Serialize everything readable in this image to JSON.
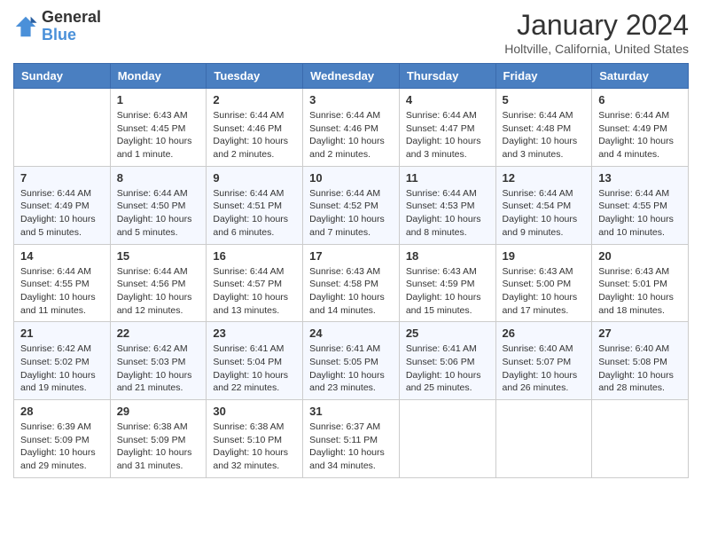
{
  "header": {
    "logo_general": "General",
    "logo_blue": "Blue",
    "month_title": "January 2024",
    "location": "Holtville, California, United States"
  },
  "columns": [
    "Sunday",
    "Monday",
    "Tuesday",
    "Wednesday",
    "Thursday",
    "Friday",
    "Saturday"
  ],
  "weeks": [
    [
      {
        "day": "",
        "info": ""
      },
      {
        "day": "1",
        "info": "Sunrise: 6:43 AM\nSunset: 4:45 PM\nDaylight: 10 hours and 1 minute."
      },
      {
        "day": "2",
        "info": "Sunrise: 6:44 AM\nSunset: 4:46 PM\nDaylight: 10 hours and 2 minutes."
      },
      {
        "day": "3",
        "info": "Sunrise: 6:44 AM\nSunset: 4:46 PM\nDaylight: 10 hours and 2 minutes."
      },
      {
        "day": "4",
        "info": "Sunrise: 6:44 AM\nSunset: 4:47 PM\nDaylight: 10 hours and 3 minutes."
      },
      {
        "day": "5",
        "info": "Sunrise: 6:44 AM\nSunset: 4:48 PM\nDaylight: 10 hours and 3 minutes."
      },
      {
        "day": "6",
        "info": "Sunrise: 6:44 AM\nSunset: 4:49 PM\nDaylight: 10 hours and 4 minutes."
      }
    ],
    [
      {
        "day": "7",
        "info": "Sunrise: 6:44 AM\nSunset: 4:49 PM\nDaylight: 10 hours and 5 minutes."
      },
      {
        "day": "8",
        "info": "Sunrise: 6:44 AM\nSunset: 4:50 PM\nDaylight: 10 hours and 5 minutes."
      },
      {
        "day": "9",
        "info": "Sunrise: 6:44 AM\nSunset: 4:51 PM\nDaylight: 10 hours and 6 minutes."
      },
      {
        "day": "10",
        "info": "Sunrise: 6:44 AM\nSunset: 4:52 PM\nDaylight: 10 hours and 7 minutes."
      },
      {
        "day": "11",
        "info": "Sunrise: 6:44 AM\nSunset: 4:53 PM\nDaylight: 10 hours and 8 minutes."
      },
      {
        "day": "12",
        "info": "Sunrise: 6:44 AM\nSunset: 4:54 PM\nDaylight: 10 hours and 9 minutes."
      },
      {
        "day": "13",
        "info": "Sunrise: 6:44 AM\nSunset: 4:55 PM\nDaylight: 10 hours and 10 minutes."
      }
    ],
    [
      {
        "day": "14",
        "info": "Sunrise: 6:44 AM\nSunset: 4:55 PM\nDaylight: 10 hours and 11 minutes."
      },
      {
        "day": "15",
        "info": "Sunrise: 6:44 AM\nSunset: 4:56 PM\nDaylight: 10 hours and 12 minutes."
      },
      {
        "day": "16",
        "info": "Sunrise: 6:44 AM\nSunset: 4:57 PM\nDaylight: 10 hours and 13 minutes."
      },
      {
        "day": "17",
        "info": "Sunrise: 6:43 AM\nSunset: 4:58 PM\nDaylight: 10 hours and 14 minutes."
      },
      {
        "day": "18",
        "info": "Sunrise: 6:43 AM\nSunset: 4:59 PM\nDaylight: 10 hours and 15 minutes."
      },
      {
        "day": "19",
        "info": "Sunrise: 6:43 AM\nSunset: 5:00 PM\nDaylight: 10 hours and 17 minutes."
      },
      {
        "day": "20",
        "info": "Sunrise: 6:43 AM\nSunset: 5:01 PM\nDaylight: 10 hours and 18 minutes."
      }
    ],
    [
      {
        "day": "21",
        "info": "Sunrise: 6:42 AM\nSunset: 5:02 PM\nDaylight: 10 hours and 19 minutes."
      },
      {
        "day": "22",
        "info": "Sunrise: 6:42 AM\nSunset: 5:03 PM\nDaylight: 10 hours and 21 minutes."
      },
      {
        "day": "23",
        "info": "Sunrise: 6:41 AM\nSunset: 5:04 PM\nDaylight: 10 hours and 22 minutes."
      },
      {
        "day": "24",
        "info": "Sunrise: 6:41 AM\nSunset: 5:05 PM\nDaylight: 10 hours and 23 minutes."
      },
      {
        "day": "25",
        "info": "Sunrise: 6:41 AM\nSunset: 5:06 PM\nDaylight: 10 hours and 25 minutes."
      },
      {
        "day": "26",
        "info": "Sunrise: 6:40 AM\nSunset: 5:07 PM\nDaylight: 10 hours and 26 minutes."
      },
      {
        "day": "27",
        "info": "Sunrise: 6:40 AM\nSunset: 5:08 PM\nDaylight: 10 hours and 28 minutes."
      }
    ],
    [
      {
        "day": "28",
        "info": "Sunrise: 6:39 AM\nSunset: 5:09 PM\nDaylight: 10 hours and 29 minutes."
      },
      {
        "day": "29",
        "info": "Sunrise: 6:38 AM\nSunset: 5:09 PM\nDaylight: 10 hours and 31 minutes."
      },
      {
        "day": "30",
        "info": "Sunrise: 6:38 AM\nSunset: 5:10 PM\nDaylight: 10 hours and 32 minutes."
      },
      {
        "day": "31",
        "info": "Sunrise: 6:37 AM\nSunset: 5:11 PM\nDaylight: 10 hours and 34 minutes."
      },
      {
        "day": "",
        "info": ""
      },
      {
        "day": "",
        "info": ""
      },
      {
        "day": "",
        "info": ""
      }
    ]
  ]
}
